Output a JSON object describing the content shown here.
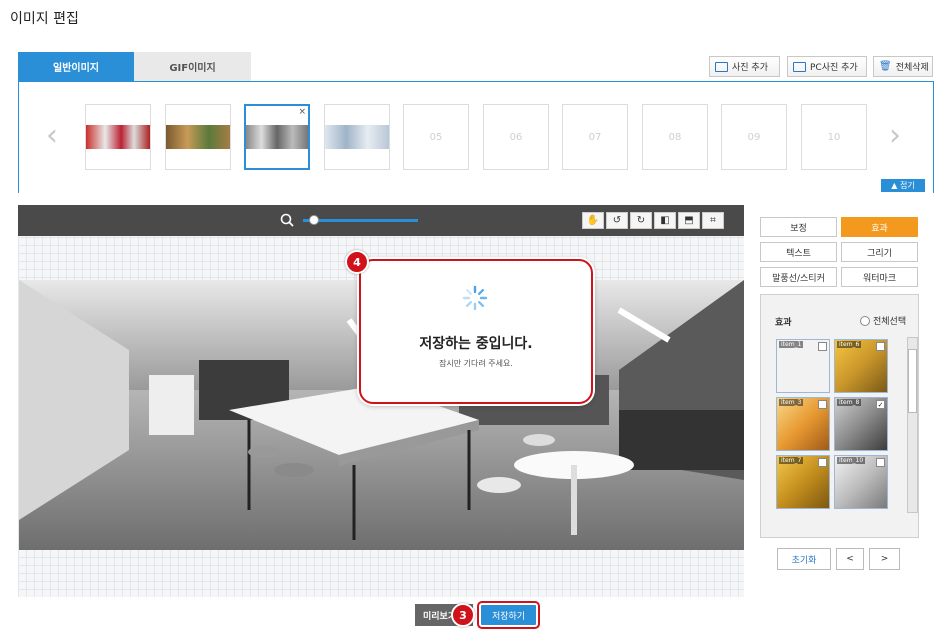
{
  "page": {
    "title": "이미지 편집"
  },
  "tabs": [
    {
      "label": "일반이미지",
      "active": true
    },
    {
      "label": "GIF이미지",
      "active": false
    }
  ],
  "top_buttons": {
    "add_photo": "사진 추가",
    "add_pc_photo": "PC사진 추가",
    "delete_all": "전체삭제"
  },
  "thumbnails": [
    {
      "slot": "01",
      "filled": true
    },
    {
      "slot": "02",
      "filled": true
    },
    {
      "slot": "03",
      "filled": true,
      "selected": true
    },
    {
      "slot": "04",
      "filled": true
    },
    {
      "slot": "05",
      "filled": false
    },
    {
      "slot": "06",
      "filled": false
    },
    {
      "slot": "07",
      "filled": false
    },
    {
      "slot": "08",
      "filled": false
    },
    {
      "slot": "09",
      "filled": false
    },
    {
      "slot": "10",
      "filled": false
    }
  ],
  "strip": {
    "fold_label": "▲ 접기"
  },
  "loading": {
    "title": "저장하는 중입니다.",
    "subtitle": "잠시만 기다려 주세요.",
    "badge": "4"
  },
  "right_tabs": [
    "보정",
    "효과",
    "텍스트",
    "그리기",
    "말풍선/스티커",
    "워터마크"
  ],
  "effects_panel": {
    "title": "효과",
    "select_all": "전체선택",
    "items": [
      {
        "label": "item_1",
        "checked": false
      },
      {
        "label": "item_6",
        "checked": false
      },
      {
        "label": "item_3",
        "checked": false
      },
      {
        "label": "item_8",
        "checked": true
      },
      {
        "label": "item_7",
        "checked": false
      },
      {
        "label": "item_10",
        "checked": false
      }
    ]
  },
  "nav": {
    "reset": "초기화",
    "prev": "<",
    "next": ">"
  },
  "bottom": {
    "preview": "미리보기",
    "save": "저장하기",
    "save_badge": "3"
  },
  "colors": {
    "accent": "#2a8fd6",
    "effect_tab": "#f39a1e",
    "highlight": "#d0131b"
  }
}
